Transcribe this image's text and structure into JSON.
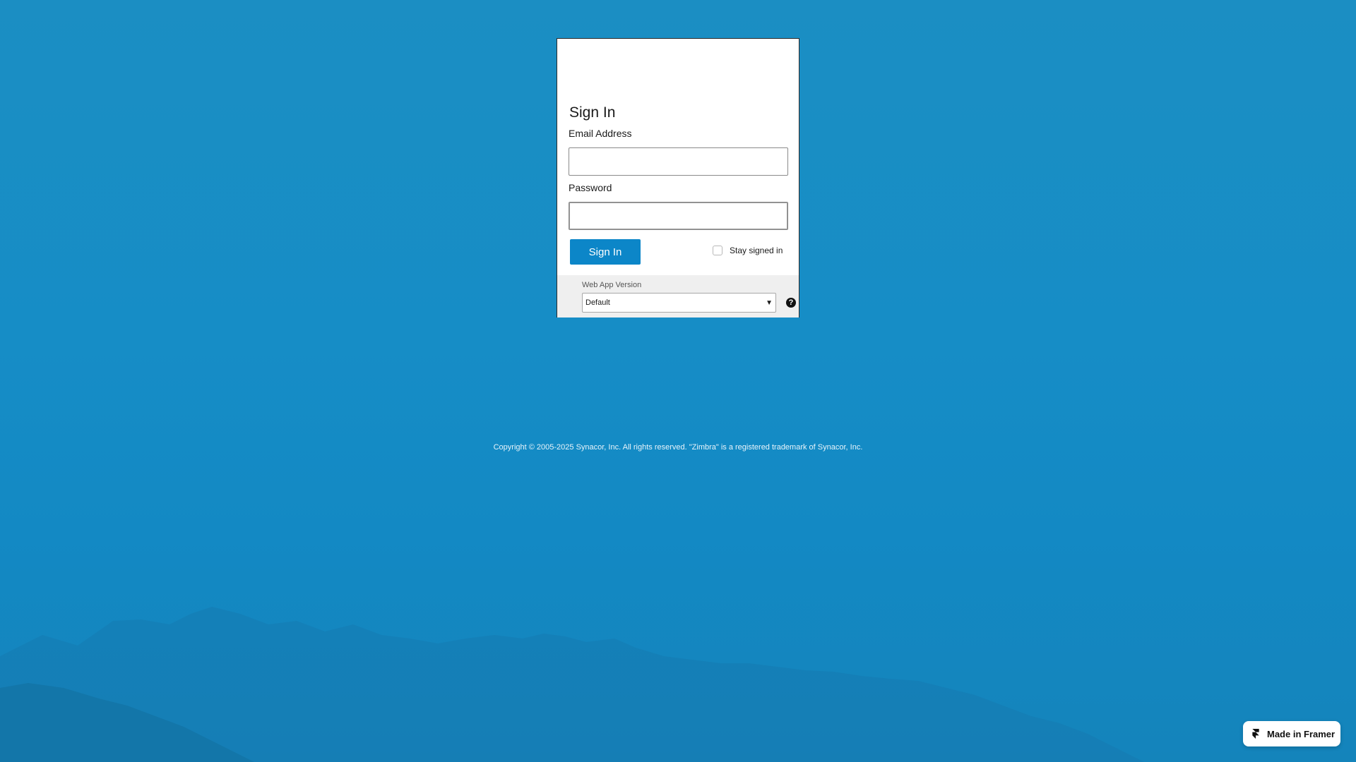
{
  "login": {
    "title": "Sign In",
    "email_label": "Email Address",
    "email_value": "",
    "password_label": "Password",
    "password_value": "",
    "signin_button": "Sign In",
    "stay_signed_in_label": "Stay signed in",
    "stay_signed_in_checked": false,
    "version_label": "Web App Version",
    "version_selected": "Default",
    "help_glyph": "?"
  },
  "copyright": "Copyright © 2005-2025 Synacor, Inc. All rights reserved. \"Zimbra\" is a registered trademark of Synacor, Inc.",
  "badge": {
    "label": "Made in Framer",
    "icon": "framer-icon"
  },
  "colors": {
    "background": "#1a8fc4",
    "button": "#0c86c8",
    "card": "#ffffff"
  }
}
